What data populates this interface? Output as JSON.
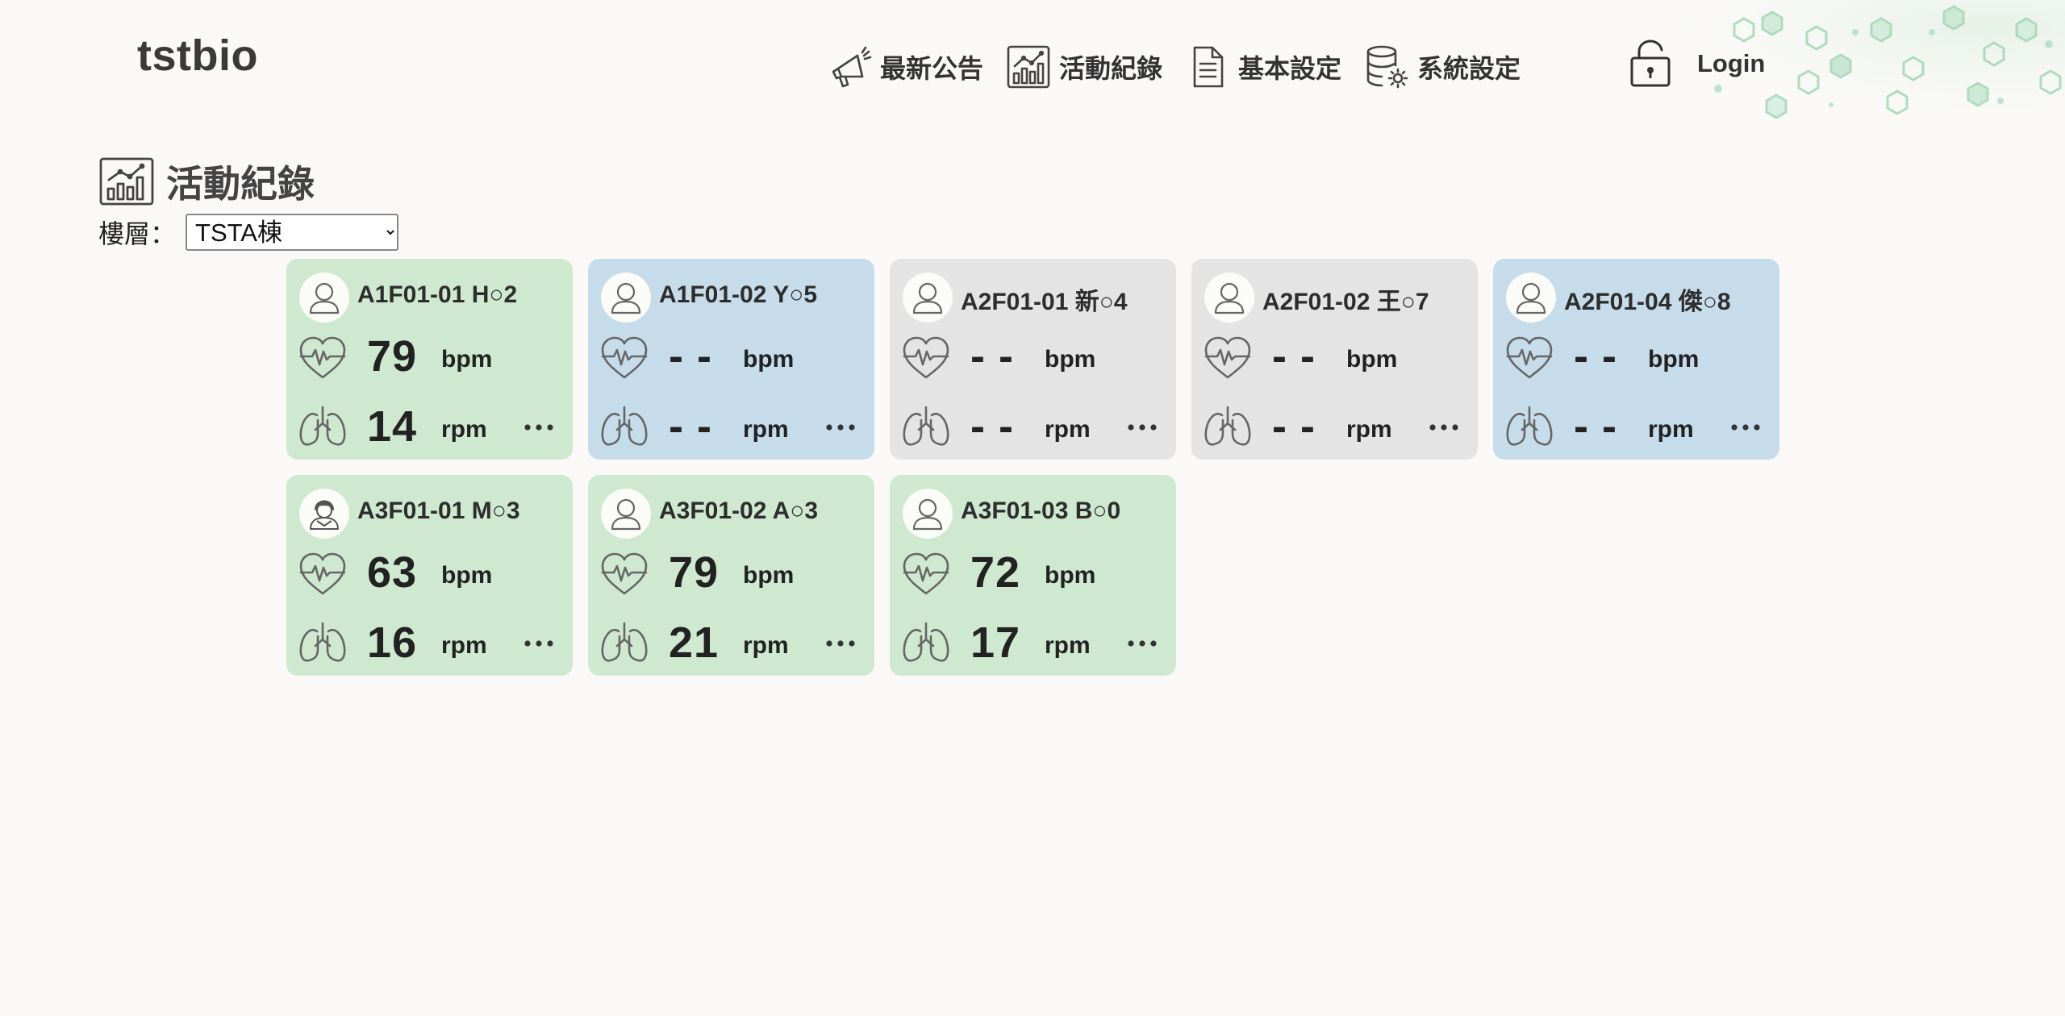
{
  "header": {
    "brand": "tstbio",
    "nav": [
      {
        "label": "最新公告",
        "icon": "megaphone-icon"
      },
      {
        "label": "活動紀錄",
        "icon": "activity-chart-icon"
      },
      {
        "label": "基本設定",
        "icon": "document-icon"
      },
      {
        "label": "系統設定",
        "icon": "database-settings-icon"
      }
    ],
    "login": {
      "label": "Login",
      "icon": "lock-icon"
    }
  },
  "page": {
    "title": "活動紀錄",
    "title_icon": "activity-chart-icon",
    "floor_label": "樓層：",
    "floor_selected": "TSTA棟"
  },
  "colors": {
    "green": "#cfe9d0",
    "blue": "#c7dcea",
    "gray": "#e4e4e4",
    "background": "#faf9f7"
  },
  "cards": [
    {
      "name": "A1F01-01 H○2",
      "hr": "79",
      "hr_unit": "bpm",
      "rr": "14",
      "rr_unit": "rpm",
      "color": "green",
      "avatar": "male"
    },
    {
      "name": "A1F01-02 Y○5",
      "hr": "- -",
      "hr_unit": "bpm",
      "rr": "- -",
      "rr_unit": "rpm",
      "color": "blue",
      "avatar": "male"
    },
    {
      "name": "A2F01-01 新○4",
      "hr": "- -",
      "hr_unit": "bpm",
      "rr": "- -",
      "rr_unit": "rpm",
      "color": "gray",
      "avatar": "male"
    },
    {
      "name": "A2F01-02 王○7",
      "hr": "- -",
      "hr_unit": "bpm",
      "rr": "- -",
      "rr_unit": "rpm",
      "color": "gray",
      "avatar": "male"
    },
    {
      "name": "A2F01-04 傑○8",
      "hr": "- -",
      "hr_unit": "bpm",
      "rr": "- -",
      "rr_unit": "rpm",
      "color": "blue",
      "avatar": "male"
    },
    {
      "name": "A3F01-01 M○3",
      "hr": "63",
      "hr_unit": "bpm",
      "rr": "16",
      "rr_unit": "rpm",
      "color": "green",
      "avatar": "female"
    },
    {
      "name": "A3F01-02 A○3",
      "hr": "79",
      "hr_unit": "bpm",
      "rr": "21",
      "rr_unit": "rpm",
      "color": "green",
      "avatar": "male"
    },
    {
      "name": "A3F01-03 B○0",
      "hr": "72",
      "hr_unit": "bpm",
      "rr": "17",
      "rr_unit": "rpm",
      "color": "green",
      "avatar": "male"
    }
  ]
}
